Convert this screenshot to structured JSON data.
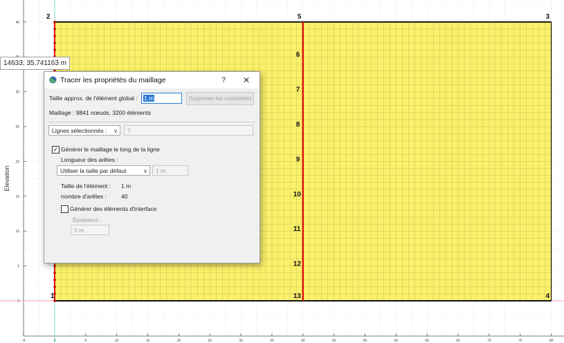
{
  "plot": {
    "ylabel": "Elevation",
    "xticks": [
      "-5",
      "0",
      "5",
      "10",
      "15",
      "20",
      "25",
      "30",
      "35",
      "40",
      "45",
      "50",
      "55",
      "60",
      "65",
      "70",
      "75",
      "80"
    ],
    "yticks": [
      "0",
      "5",
      "10",
      "15",
      "20",
      "25",
      "30",
      "35",
      "40"
    ],
    "point_labels": [
      "1",
      "2",
      "3",
      "4",
      "5",
      "6",
      "7",
      "8",
      "9",
      "10",
      "11",
      "12",
      "13"
    ],
    "colors": {
      "fill": "#fbf06a",
      "mesh": "#c9c25a",
      "boundary": "#111111",
      "selected_line": "#e01010",
      "node": "#c00000",
      "axis_guide_v": "#7be0c0",
      "axis_guide_h": "#f4a0a0"
    },
    "coord_tooltip": "14633; 35,741163 m"
  },
  "dialog": {
    "title": "Tracer les propriétés du maillage",
    "help": "?",
    "close": "✕",
    "global_size_label": "Taille approx. de l'élément global :",
    "global_size_value": "1 m",
    "remove_constraints": "Supprimer les contraintes",
    "mesh_info": "Maillage : 9841 nœuds, 3200 éléments",
    "selection_combo": "Lignes sélectionnés :",
    "selection_count": "7",
    "gen_along_line": "Générer le maillage le long de la ligne",
    "gen_along_line_checked": true,
    "edge_length_label": "Longueur des arêtes :",
    "edge_mode": "Utiliser la taille par défaut",
    "edge_value": "1 m",
    "element_size_label": "Taille de l'élément :",
    "element_size_value": "1 m",
    "edge_count_label": "nombre d'arêtes :",
    "edge_count_value": "40",
    "gen_interface": "Générer des éléments d'interface",
    "gen_interface_checked": false,
    "thickness_label": "Épaisseur :",
    "thickness_value": "0 m"
  }
}
